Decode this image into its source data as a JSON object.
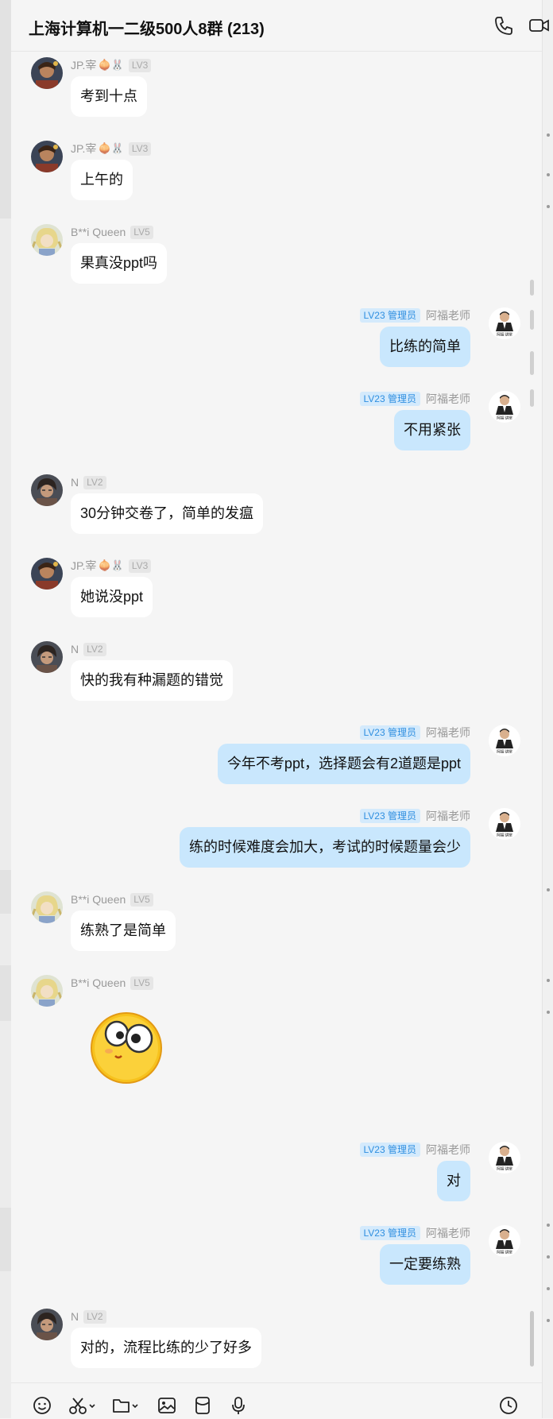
{
  "header": {
    "title": "上海计算机一二级500人8群 (213)",
    "phone_icon": "phone-icon",
    "video_icon": "video-camera-icon"
  },
  "users": {
    "jp": {
      "name": "JP.宰",
      "emoji": "🧅🐰",
      "level": "LV3"
    },
    "bqueen": {
      "name": "B**i Queen",
      "level": "LV5"
    },
    "n": {
      "name": "N",
      "level": "LV2"
    },
    "teacher": {
      "name": "阿福老师",
      "badge": "LV23 管理员"
    }
  },
  "messages": [
    {
      "side": "left",
      "user": "jp",
      "text": "考到十点"
    },
    {
      "side": "left",
      "user": "jp",
      "text": "上午的"
    },
    {
      "side": "left",
      "user": "bqueen",
      "text": "果真没ppt吗"
    },
    {
      "side": "right",
      "user": "teacher",
      "text": "比练的简单"
    },
    {
      "side": "right",
      "user": "teacher",
      "text": "不用紧张"
    },
    {
      "side": "left",
      "user": "n",
      "text": "30分钟交卷了，简单的发瘟"
    },
    {
      "side": "left",
      "user": "jp",
      "text": "她说没ppt"
    },
    {
      "side": "left",
      "user": "n",
      "text": "快的我有种漏题的错觉"
    },
    {
      "side": "right",
      "user": "teacher",
      "text": "今年不考ppt，选择题会有2道题是ppt"
    },
    {
      "side": "right",
      "user": "teacher",
      "text": "练的时候难度会加大，考试的时候题量会少"
    },
    {
      "side": "left",
      "user": "bqueen",
      "text": "练熟了是简单"
    },
    {
      "side": "left",
      "user": "bqueen",
      "sticker": "googly-eyes-emoji-sticker"
    },
    {
      "side": "right",
      "user": "teacher",
      "text": "对"
    },
    {
      "side": "right",
      "user": "teacher",
      "text": "一定要练熟"
    },
    {
      "side": "left",
      "user": "n",
      "text": "对的，流程比练的少了好多"
    }
  ],
  "toolbar": {
    "icons": [
      "emoji-icon",
      "scissors-icon",
      "folder-icon",
      "image-icon",
      "red-packet-icon",
      "microphone-icon",
      "history-clock-icon"
    ]
  },
  "colors": {
    "background": "#f5f5f5",
    "my_bubble": "#c9e7fd",
    "other_bubble": "#ffffff",
    "admin_badge_bg": "#d4eafc",
    "admin_badge_text": "#2f8fe0"
  }
}
